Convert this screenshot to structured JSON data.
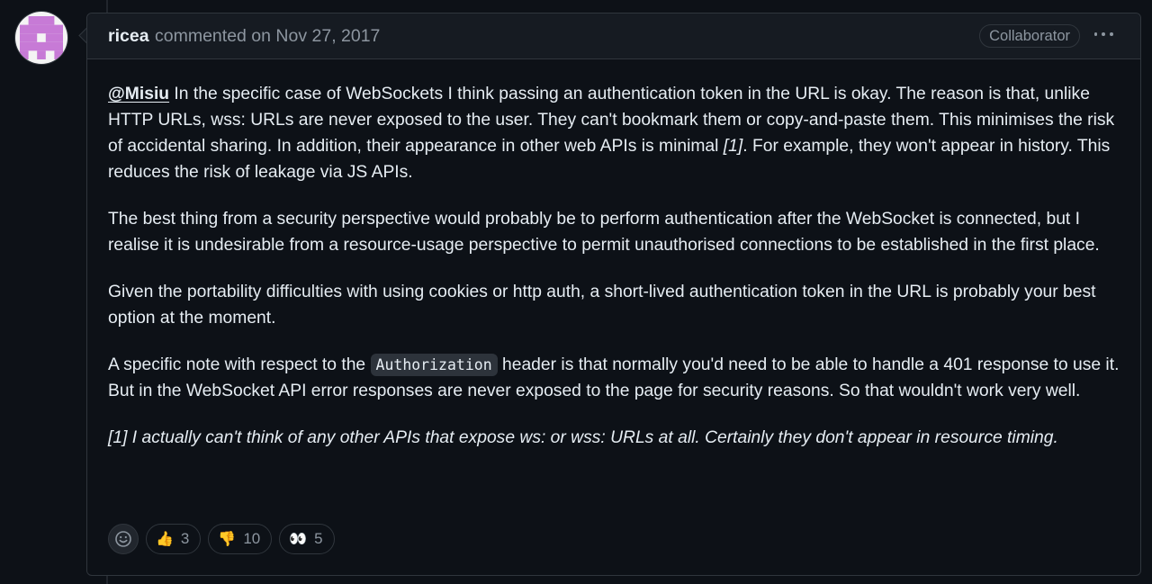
{
  "comment": {
    "author": "ricea",
    "action": "commented on Nov 27, 2017",
    "role_badge": "Collaborator",
    "paragraphs": {
      "p1_mention": "@Misiu",
      "p1_text_a": " In the specific case of WebSockets I think passing an authentication token in the URL is okay. The reason is that, unlike HTTP URLs, wss: URLs are never exposed to the user. They can't bookmark them or copy-and-paste them. This minimises the risk of accidental sharing. In addition, their appearance in other web APIs is minimal ",
      "p1_footnote_ref": "[1]",
      "p1_text_b": ". For example, they won't appear in history. This reduces the risk of leakage via JS APIs.",
      "p2": "The best thing from a security perspective would probably be to perform authentication after the WebSocket is connected, but I realise it is undesirable from a resource-usage perspective to permit unauthorised connections to be established in the first place.",
      "p3": "Given the portability difficulties with using cookies or http auth, a short-lived authentication token in the URL is probably your best option at the moment.",
      "p4_text_a": "A specific note with respect to the ",
      "p4_code": "Authorization",
      "p4_text_b": " header is that normally you'd need to be able to handle a 401 response to use it. But in the WebSocket API error responses are never exposed to the page for security reasons. So that wouldn't work very well.",
      "p5": "[1] I actually can't think of any other APIs that expose ws: or wss: URLs at all. Certainly they don't appear in resource timing."
    },
    "reactions": [
      {
        "icon": "thumbs-up-icon",
        "emoji": "👍",
        "count": "3"
      },
      {
        "icon": "thumbs-down-icon",
        "emoji": "👎",
        "count": "10"
      },
      {
        "icon": "eyes-icon",
        "emoji": "👀",
        "count": "5"
      }
    ]
  },
  "colors": {
    "background": "#0d1117",
    "header_bg": "#161b22",
    "border": "#30363d",
    "text": "#e6edf3",
    "muted": "#8d96a0",
    "avatar_accent": "#c77ad6"
  }
}
